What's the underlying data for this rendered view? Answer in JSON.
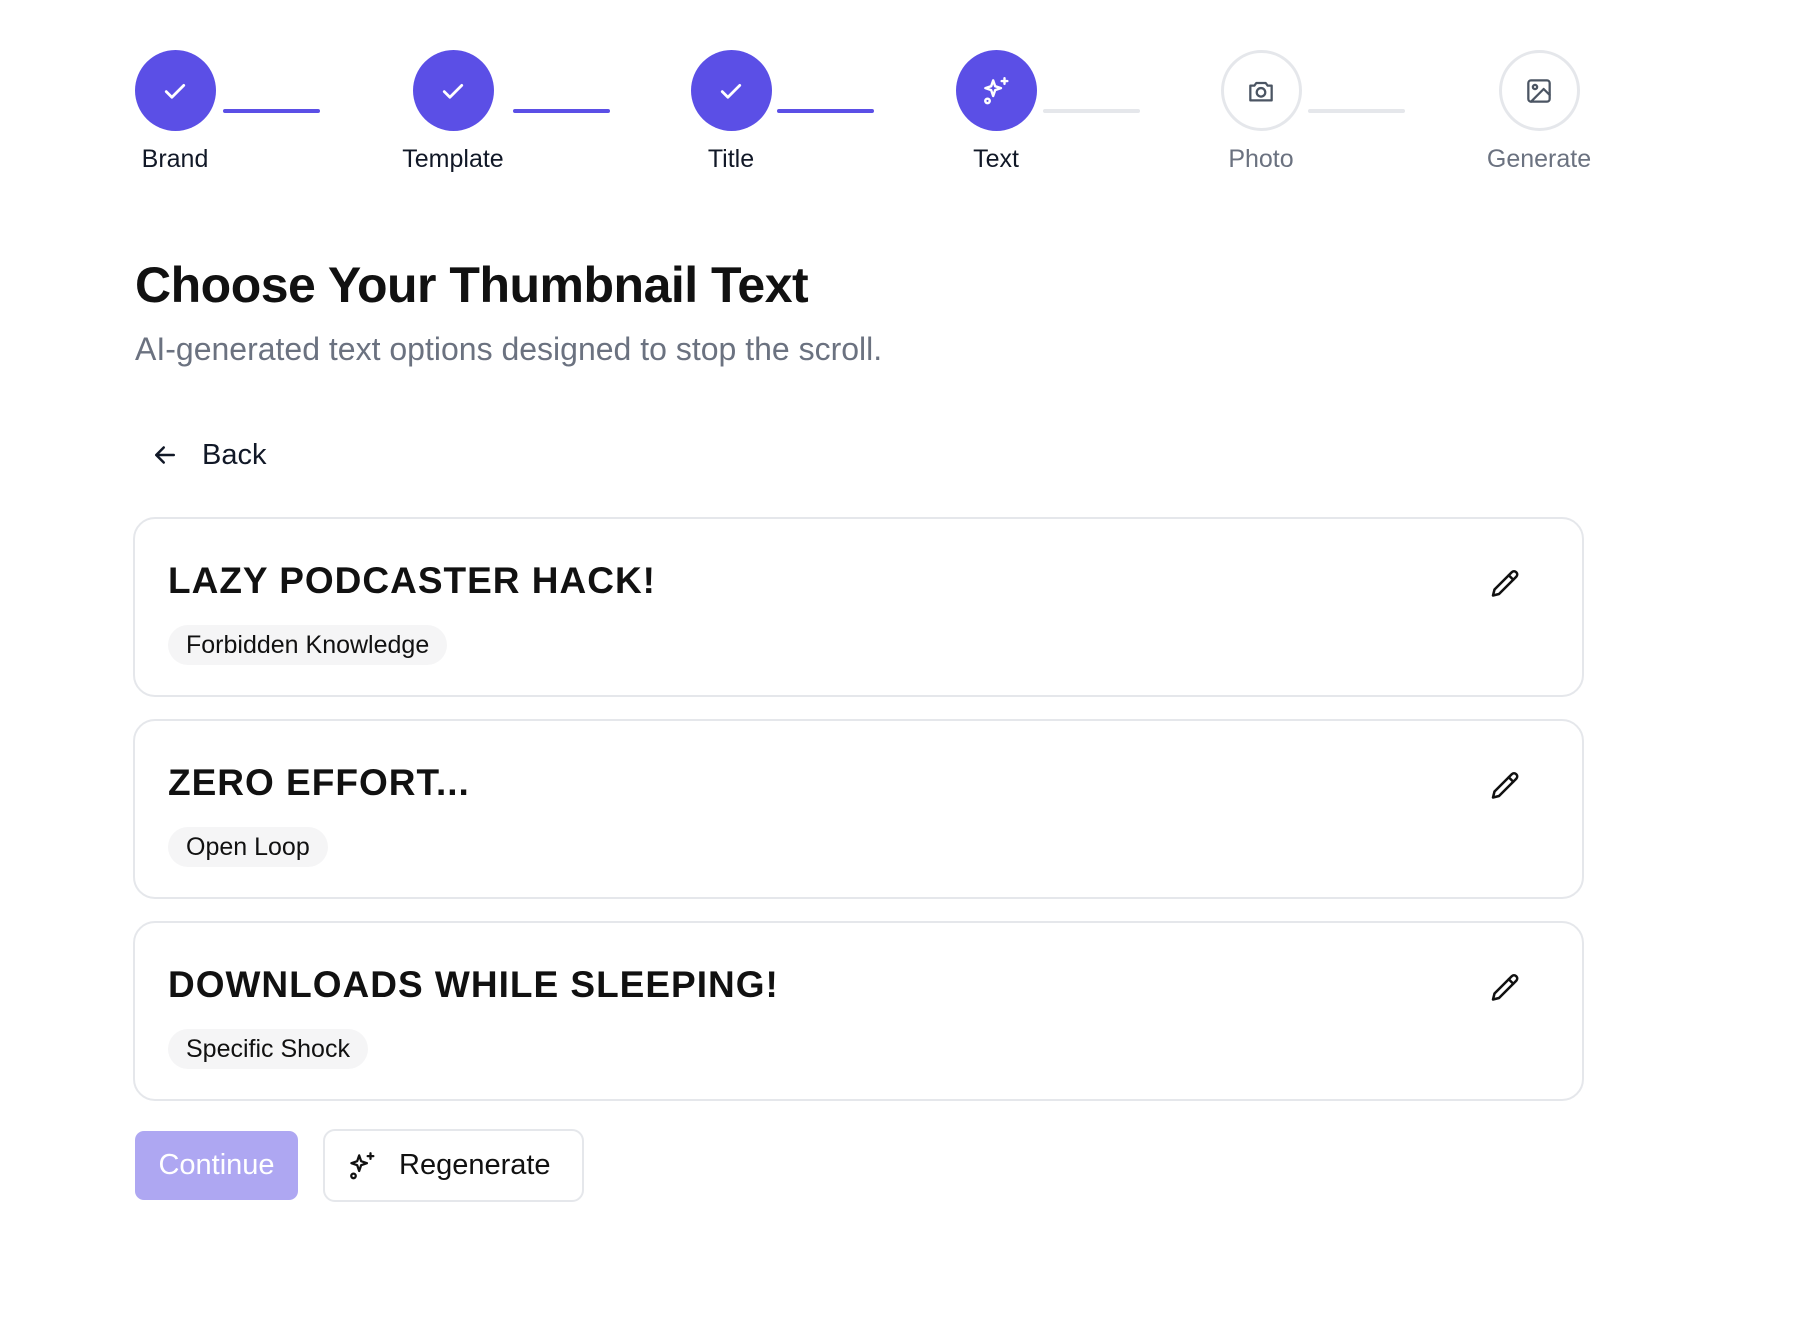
{
  "stepper": {
    "steps": [
      {
        "label": "Brand",
        "status": "done",
        "icon": "check-icon"
      },
      {
        "label": "Template",
        "status": "done",
        "icon": "check-icon"
      },
      {
        "label": "Title",
        "status": "done",
        "icon": "check-icon"
      },
      {
        "label": "Text",
        "status": "current",
        "icon": "sparkles-icon"
      },
      {
        "label": "Photo",
        "status": "todo",
        "icon": "camera-icon"
      },
      {
        "label": "Generate",
        "status": "todo",
        "icon": "image-icon"
      }
    ]
  },
  "header": {
    "title": "Choose Your Thumbnail Text",
    "subtitle": "AI-generated text options designed to stop the scroll."
  },
  "back": {
    "label": "Back",
    "icon": "arrow-left-icon"
  },
  "options": [
    {
      "headline": "LAZY PODCASTER HACK!",
      "tag": "Forbidden Knowledge",
      "icon": "pencil-icon"
    },
    {
      "headline": "ZERO EFFORT...",
      "tag": "Open Loop",
      "icon": "pencil-icon"
    },
    {
      "headline": "DOWNLOADS WHILE SLEEPING!",
      "tag": "Specific Shock",
      "icon": "pencil-icon"
    }
  ],
  "actions": {
    "continue_label": "Continue",
    "continue_disabled": true,
    "regenerate_label": "Regenerate",
    "regenerate_icon": "sparkles-icon"
  },
  "colors": {
    "accent": "#5b4fe6",
    "accent_disabled": "#aea7f2",
    "border": "#e5e7eb",
    "muted_text": "#6b7280",
    "tag_bg": "#f5f5f6"
  }
}
